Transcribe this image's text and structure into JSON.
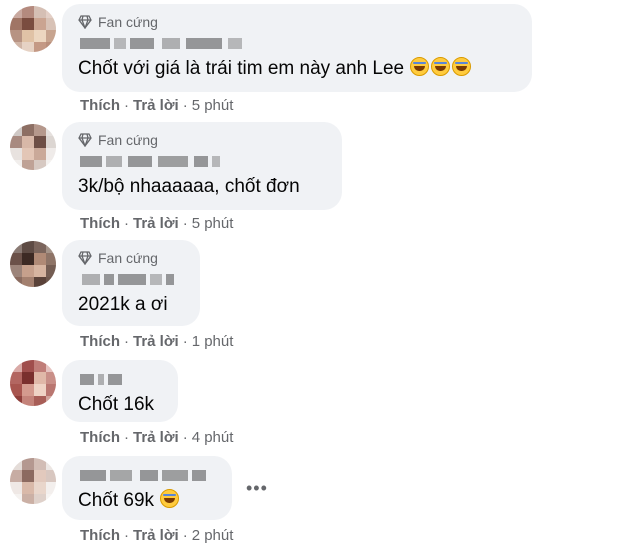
{
  "comments": [
    {
      "badge": "Fan cứng",
      "text": "Chốt với giá là trái tim em này anh Lee",
      "emoji_count": 3,
      "like": "Thích",
      "reply": "Trả lời",
      "time": "5 phút"
    },
    {
      "badge": "Fan cứng",
      "text": "3k/bộ nhaaaaaa, chốt đơn",
      "emoji_count": 0,
      "like": "Thích",
      "reply": "Trả lời",
      "time": "5 phút"
    },
    {
      "badge": "Fan cứng",
      "text": "2021k a ơi",
      "emoji_count": 0,
      "like": "Thích",
      "reply": "Trả lời",
      "time": "1 phút"
    },
    {
      "badge": "",
      "text": "Chốt 16k",
      "emoji_count": 0,
      "like": "Thích",
      "reply": "Trả lời",
      "time": "4 phút"
    },
    {
      "badge": "",
      "text": "Chốt 69k",
      "emoji_count": 1,
      "like": "Thích",
      "reply": "Trả lời",
      "time": "2 phút"
    }
  ],
  "more_options": "•••",
  "separator": "·",
  "badge_icon": "diamond-icon",
  "emoji_icon": "laughing-tears-emoji-icon",
  "colors": {
    "bubble": "#f0f2f5",
    "meta": "#65676b",
    "text": "#050505"
  }
}
